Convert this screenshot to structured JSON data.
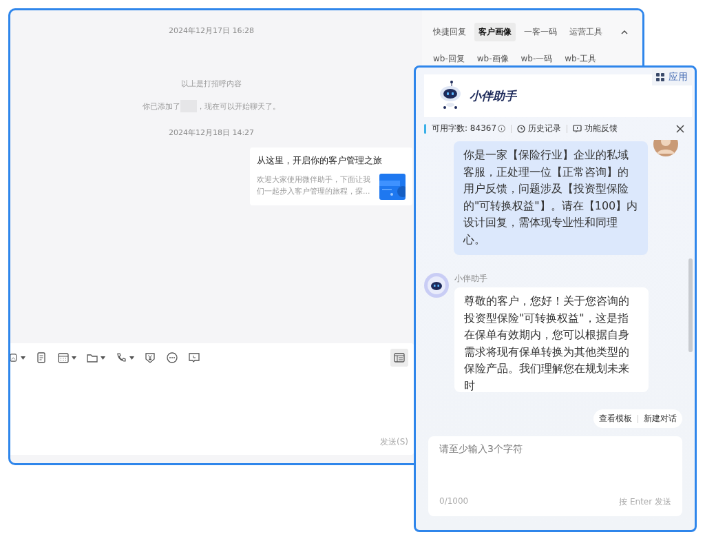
{
  "chat": {
    "messages": [
      {
        "kind": "time",
        "text": "2024年12月17日 16:28"
      },
      {
        "kind": "notice",
        "text": "以上是打招呼内容"
      },
      {
        "kind": "added",
        "before": "你已添加了",
        "after": "，现在可以开始聊天了。"
      },
      {
        "kind": "time",
        "text": "2024年12月18日 14:27"
      },
      {
        "kind": "card",
        "title": "从这里，开启你的客户管理之旅",
        "desc": "欢迎大家使用微伴助手，下面让我们一起步入客户管理的旅程，探..."
      }
    ],
    "send_label": "发送(S)"
  },
  "side_tabs": [
    [
      {
        "label": "快捷回复",
        "selected": false
      },
      {
        "label": "客户画像",
        "selected": true
      },
      {
        "label": "一客一码",
        "selected": false
      },
      {
        "label": "运营工具",
        "selected": false
      }
    ],
    [
      {
        "label": "wb-回复",
        "selected": false
      },
      {
        "label": "wb-画像",
        "selected": false
      },
      {
        "label": "wb-一码",
        "selected": false
      },
      {
        "label": "wb-工具",
        "selected": false
      }
    ]
  ],
  "assistant": {
    "title": "小伴助手",
    "apps_label": "应用",
    "quota": "可用字数: 84367",
    "history": "历史记录",
    "feedback": "功能反馈",
    "messages": [
      {
        "kind": "user",
        "text": "你是一家【保险行业】企业的私域客服，正处理一位【正常咨询】的用户反馈，问题涉及【投资型保险的\"可转换权益\"】。请在【100】内设计回复，需体现专业性和同理心。"
      },
      {
        "kind": "bot",
        "name": "小伴助手",
        "text": "尊敬的客户，您好！关于您咨询的投资型保险\"可转换权益\"，这是指在保单有效期内，您可以根据自身需求将现有保单转换为其他类型的保险产品。我们理解您在规划未来时"
      }
    ],
    "actions": [
      "查看模板",
      "新建对话"
    ],
    "input": {
      "placeholder": "请至少输入3个字符",
      "count": "0/1000",
      "hint": "按 Enter 发送"
    }
  }
}
